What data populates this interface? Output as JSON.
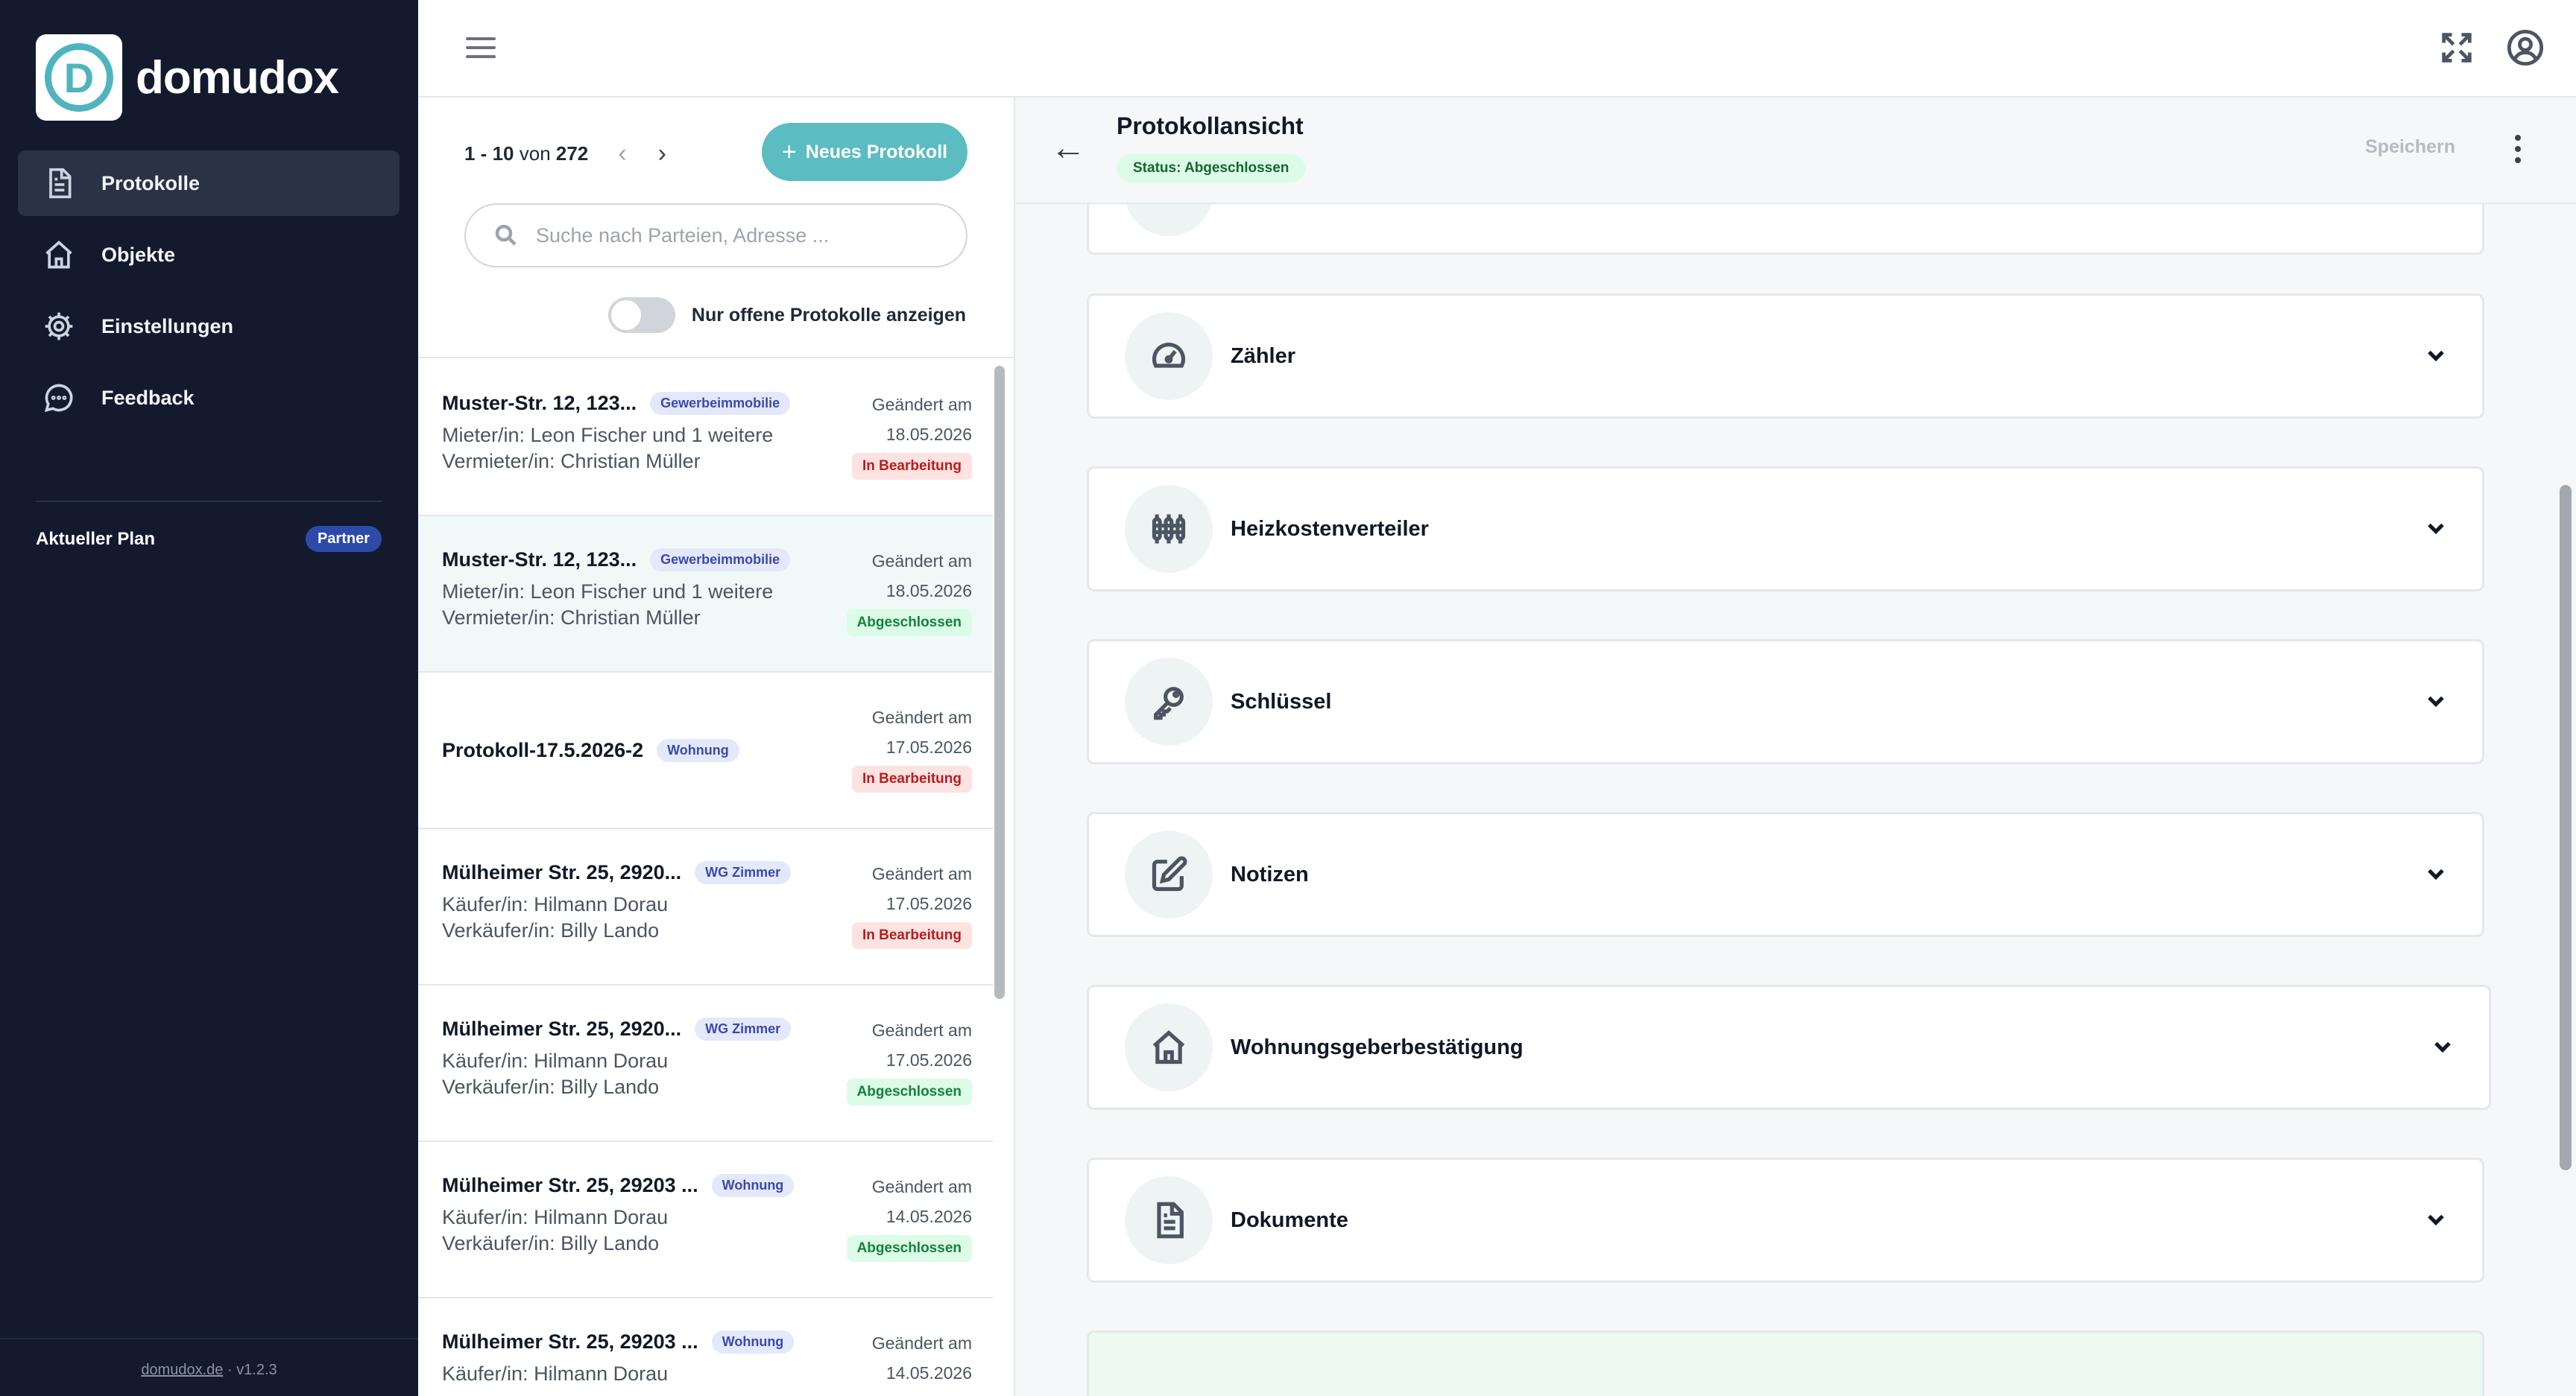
{
  "brand": {
    "name": "domudox",
    "logo_letter": "D"
  },
  "sidebar": {
    "items": [
      {
        "label": "Protokolle",
        "icon": "document-icon",
        "active": true
      },
      {
        "label": "Objekte",
        "icon": "home-icon"
      },
      {
        "label": "Einstellungen",
        "icon": "gear-icon"
      },
      {
        "label": "Feedback",
        "icon": "chat-icon"
      }
    ],
    "plan_label": "Aktueller Plan",
    "plan_badge": "Partner",
    "footer_link": "domudox.de",
    "footer_sep": "·",
    "footer_version": "v1.2.3"
  },
  "list": {
    "pager_range": "1 - 10",
    "pager_of": "von",
    "pager_total": "272",
    "new_button": "Neues Protokoll",
    "search_placeholder": "Suche nach Parteien, Adresse ...",
    "toggle_label": "Nur offene Protokolle anzeigen",
    "items": [
      {
        "title": "Muster-Str. 12, 123...",
        "tag": "Gewerbeimmobilie",
        "line1": "Mieter/in: Leon Fischer und 1 weitere",
        "line2": "Vermieter/in: Christian Müller",
        "changed": "Geändert am",
        "date": "18.05.2026",
        "status": "In Bearbeitung",
        "status_color": "#b91c1c"
      },
      {
        "title": "Muster-Str. 12, 123...",
        "tag": "Gewerbeimmobilie",
        "line1": "Mieter/in: Leon Fischer und 1 weitere",
        "line2": "Vermieter/in: Christian Müller",
        "changed": "Geändert am",
        "date": "18.05.2026",
        "status": "Abgeschlossen",
        "status_color": "#15803d"
      },
      {
        "title": "Protokoll-17.5.2026-2",
        "tag": "Wohnung",
        "line1": "",
        "line2": "",
        "changed": "Geändert am",
        "date": "17.05.2026",
        "status": "In Bearbeitung",
        "status_color": "#b91c1c"
      },
      {
        "title": "Mülheimer Str. 25, 2920...",
        "tag": "WG Zimmer",
        "line1": "Käufer/in: Hilmann Dorau",
        "line2": "Verkäufer/in: Billy Lando",
        "changed": "Geändert am",
        "date": "17.05.2026",
        "status": "In Bearbeitung",
        "status_color": "#b91c1c"
      },
      {
        "title": "Mülheimer Str. 25, 2920...",
        "tag": "WG Zimmer",
        "line1": "Käufer/in: Hilmann Dorau",
        "line2": "Verkäufer/in: Billy Lando",
        "changed": "Geändert am",
        "date": "17.05.2026",
        "status": "Abgeschlossen",
        "status_color": "#15803d"
      },
      {
        "title": "Mülheimer Str. 25, 29203 ...",
        "tag": "Wohnung",
        "line1": "Käufer/in: Hilmann Dorau",
        "line2": "Verkäufer/in: Billy Lando",
        "changed": "Geändert am",
        "date": "14.05.2026",
        "status": "Abgeschlossen",
        "status_color": "#15803d"
      },
      {
        "title": "Mülheimer Str. 25, 29203 ...",
        "tag": "Wohnung",
        "line1": "Käufer/in: Hilmann Dorau",
        "line2": "",
        "changed": "Geändert am",
        "date": "14.05.2026",
        "status": "",
        "status_color": "#15803d"
      }
    ]
  },
  "detail": {
    "title": "Protokollansicht",
    "status_badge": "Status: Abgeschlossen",
    "save_label": "Speichern",
    "sections": [
      {
        "label": "Zähler",
        "icon": "gauge-icon"
      },
      {
        "label": "Heizkostenverteiler",
        "icon": "heater-icon"
      },
      {
        "label": "Schlüssel",
        "icon": "key-icon"
      },
      {
        "label": "Notizen",
        "icon": "edit-icon"
      },
      {
        "label": "Wohnungsgeberbestätigung",
        "icon": "home-icon"
      },
      {
        "label": "Dokumente",
        "icon": "document-icon"
      }
    ]
  }
}
